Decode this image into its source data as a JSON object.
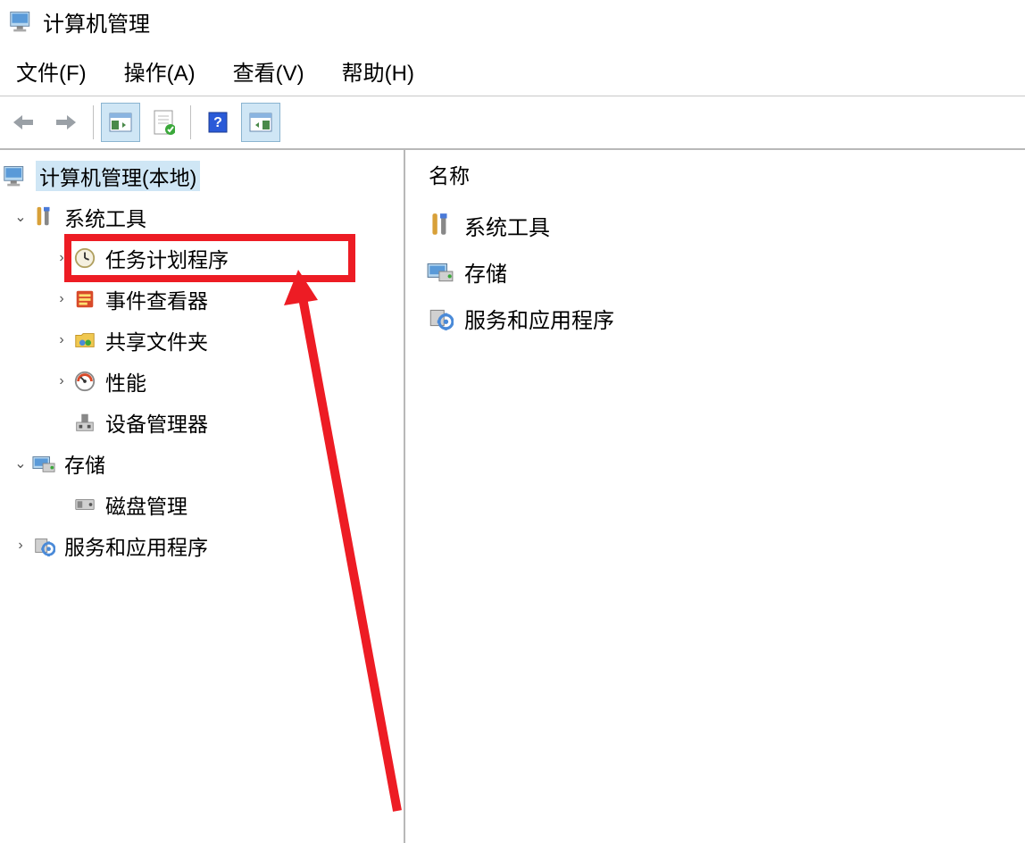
{
  "window": {
    "title": "计算机管理"
  },
  "menu": {
    "file": "文件(F)",
    "action": "操作(A)",
    "view": "查看(V)",
    "help": "帮助(H)"
  },
  "tree": {
    "root": "计算机管理(本地)",
    "system_tools": "系统工具",
    "task_scheduler": "任务计划程序",
    "event_viewer": "事件查看器",
    "shared_folders": "共享文件夹",
    "performance": "性能",
    "device_manager": "设备管理器",
    "storage": "存储",
    "disk_management": "磁盘管理",
    "services_apps": "服务和应用程序"
  },
  "right": {
    "header": "名称",
    "items": {
      "system_tools": "系统工具",
      "storage": "存储",
      "services_apps": "服务和应用程序"
    }
  }
}
